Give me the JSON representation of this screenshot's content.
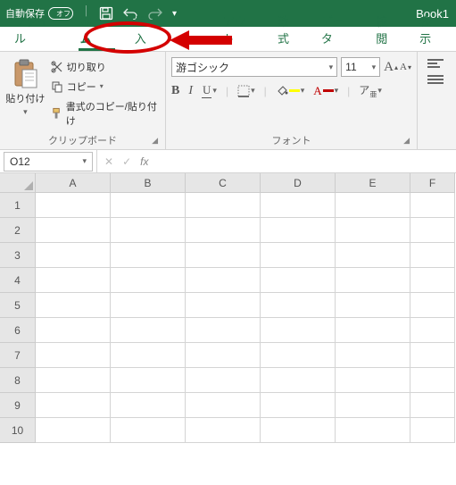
{
  "titlebar": {
    "autosave_label": "自動保存",
    "autosave_state": "オフ",
    "book_name": "Book1"
  },
  "tabs": {
    "file": "ファイル",
    "home": "ホーム",
    "insert": "挿入",
    "layout": "アウト",
    "formulas": "数式",
    "data": "データ",
    "review": "校閲",
    "view": "表示"
  },
  "clipboard": {
    "paste": "貼り付け",
    "cut": "切り取り",
    "copy": "コピー",
    "format_painter": "書式のコピー/貼り付け",
    "group_label": "クリップボード"
  },
  "font": {
    "name": "游ゴシック",
    "size": "11",
    "group_label": "フォント"
  },
  "namebox": {
    "value": "O12"
  },
  "columns": [
    "A",
    "B",
    "C",
    "D",
    "E",
    "F"
  ],
  "rows": [
    "1",
    "2",
    "3",
    "4",
    "5",
    "6",
    "7",
    "8",
    "9",
    "10"
  ]
}
